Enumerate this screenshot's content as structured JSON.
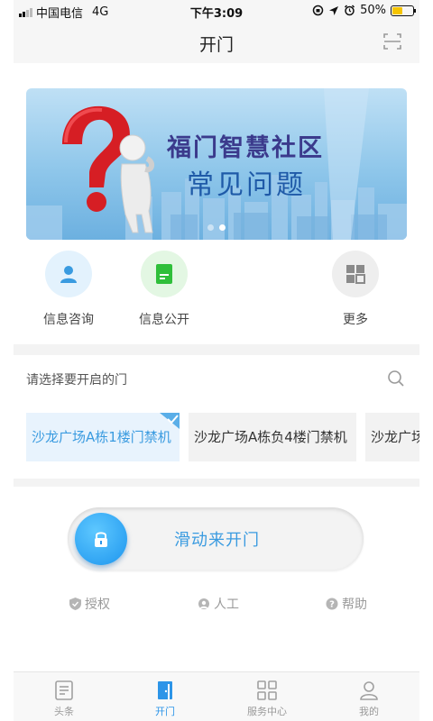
{
  "status_bar": {
    "carrier": "中国电信",
    "network": "4G",
    "time": "下午3:09",
    "battery": "50%"
  },
  "nav": {
    "title": "开门",
    "scan_icon": "scan-icon"
  },
  "banner": {
    "title": "福门智慧社区",
    "subtitle": "常见问题"
  },
  "quick_actions": [
    {
      "label": "信息咨询",
      "icon": "person-icon",
      "color": "#3a9be0",
      "bg": "#e3f2fd"
    },
    {
      "label": "信息公开",
      "icon": "document-icon",
      "color": "#2fbf3a",
      "bg": "#e3f7e3"
    },
    {
      "label": "更多",
      "icon": "grid-icon",
      "color": "#8a8a8a",
      "bg": "#eeeeee"
    }
  ],
  "door_select": {
    "prompt": "请选择要开启的门",
    "doors": [
      "沙龙广场A栋1楼门禁机",
      "沙龙广场A栋负4楼门禁机",
      "沙龙广场"
    ],
    "selected_index": 0
  },
  "slider": {
    "label": "滑动来开门"
  },
  "helpers": [
    "授权",
    "人工",
    "帮助"
  ],
  "tabs": [
    {
      "label": "头条",
      "active": false
    },
    {
      "label": "开门",
      "active": true
    },
    {
      "label": "服务中心",
      "active": false
    },
    {
      "label": "我的",
      "active": false
    }
  ],
  "colors": {
    "accent": "#3a9be0",
    "active_tab": "#2d95e8"
  }
}
